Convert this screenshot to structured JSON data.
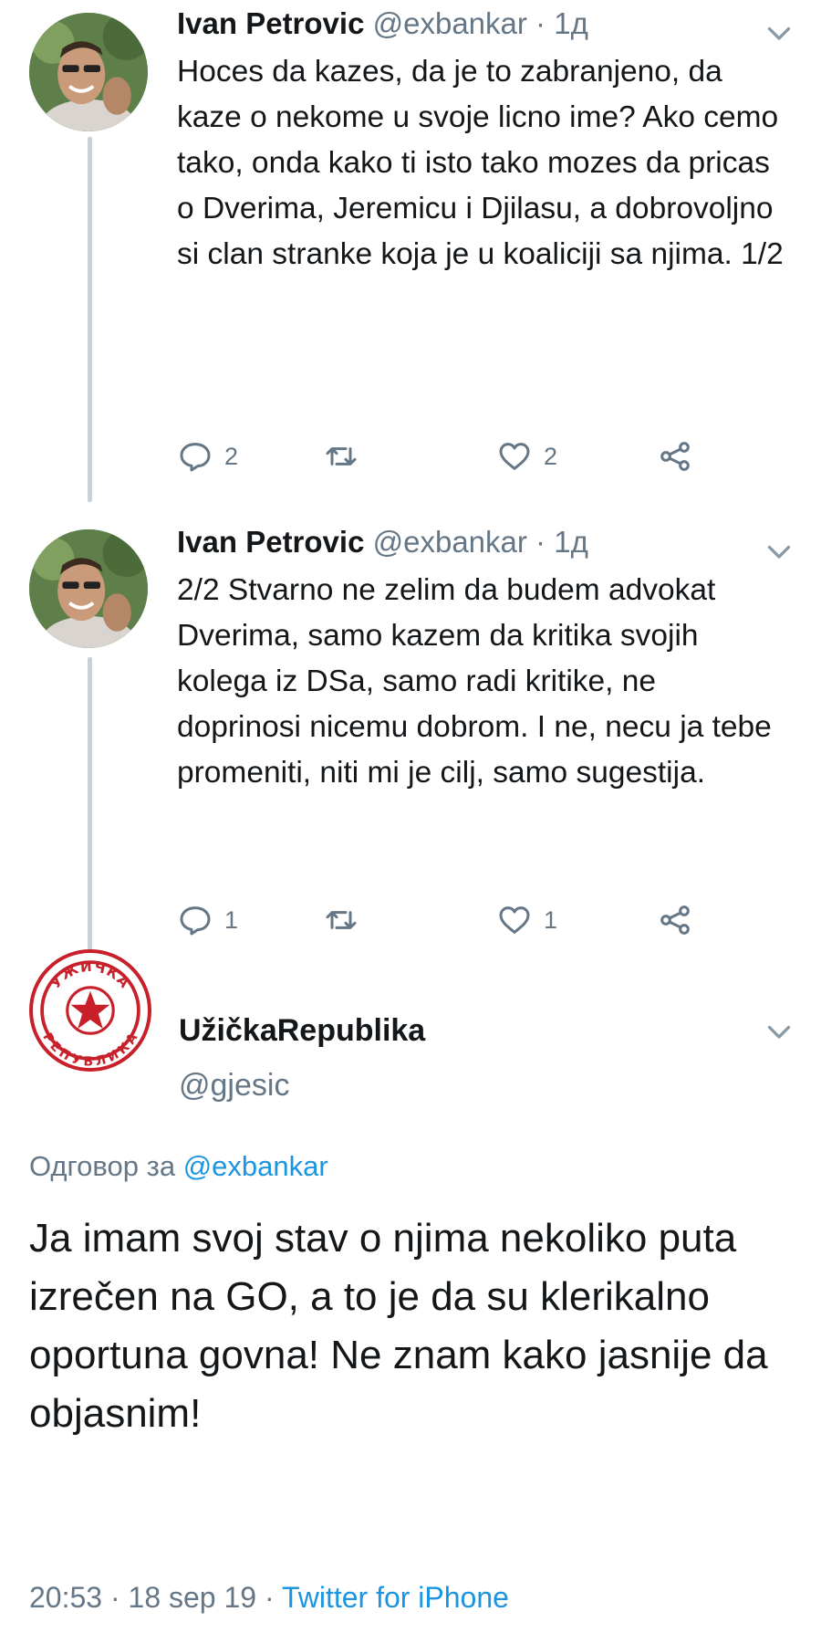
{
  "thread": [
    {
      "author_name": "Ivan Petrovic",
      "author_handle": "@exbankar",
      "separator": "·",
      "time": "1д",
      "text": "Hoces da kazes, da je to zabranjeno, da kaze o nekome u svoje licno ime? Ako cemo tako, onda kako ti isto tako mozes da pricas o Dverima, Jeremicu i Djilasu, a dobrovoljno si clan stranke koja je u koaliciji sa njima. 1/2",
      "replies": "2",
      "retweets": "",
      "likes": "2"
    },
    {
      "author_name": "Ivan Petrovic",
      "author_handle": "@exbankar",
      "separator": "·",
      "time": "1д",
      "text": "2/2 Stvarno ne zelim da budem advokat Dverima, samo kazem da kritika svojih kolega iz DSa, samo radi kritike, ne doprinosi nicemu dobrom. I ne, necu ja tebe promeniti, niti mi je cilj, samo sugestija.",
      "replies": "1",
      "retweets": "",
      "likes": "1"
    }
  ],
  "main_tweet": {
    "author_name": "UžičkaRepublika",
    "author_handle": "@gjesic",
    "reply_prefix": "Одговор за",
    "reply_target": "@exbankar",
    "text": "Ja imam svoj stav o njima nekoliko puta izrečen na GO, a to je da su klerikalno oportuna govna! Ne znam kako jasnije da objasnim!",
    "timestamp": "20:53 · 18 sep 19 · ",
    "source": "Twitter for iPhone",
    "avatar_text_top": "УЖИЧКА",
    "avatar_text_bottom": "РЕПУБЛИКА"
  },
  "icons": {
    "reply": "reply-icon",
    "retweet": "retweet-icon",
    "like": "heart-icon",
    "share": "share-icon",
    "menu": "chevron-down-icon"
  },
  "colors": {
    "text": "#14171a",
    "muted": "#657786",
    "link": "#1b95e0",
    "thread_line": "#c9d2da",
    "brand_red": "#c8202a"
  }
}
